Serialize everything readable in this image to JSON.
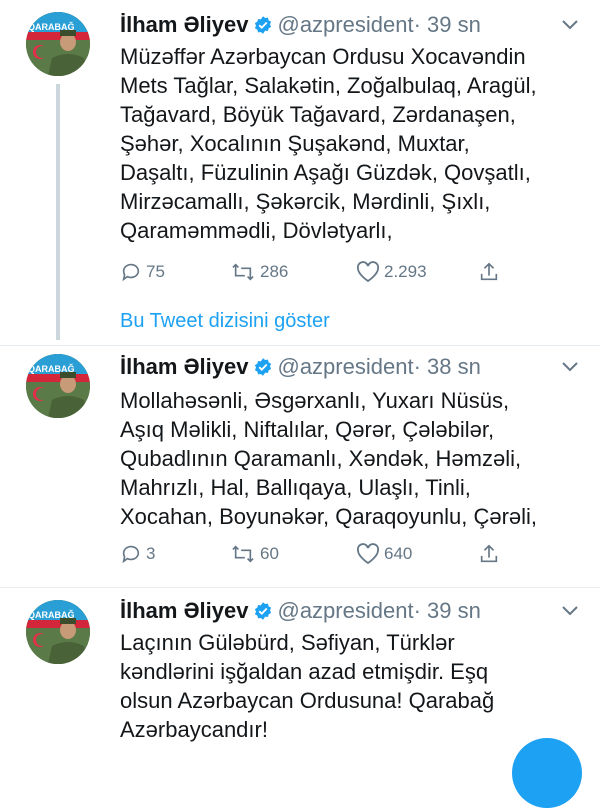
{
  "tweets": [
    {
      "name": "İlham Əliyev",
      "handle": "@azpresident",
      "dot": "·",
      "time": "39 sn",
      "lines": [
        "Müzəffər Azərbaycan Ordusu Xocavəndin",
        "Mets Tağlar, Salakətin, Zoğalbulaq, Aragül,",
        "Tağavard, Böyük Tağavard, Zərdanaşen,",
        "Şəhər, Xocalının Şuşakənd, Muxtar,",
        "Daşaltı, Füzulinin Aşağı Güzdək, Qovşatlı,",
        "Mirzəcamallı, Şəkərcik, Mərdinli, Şıxlı,",
        "Qaraməmmədli, Dövlətyarlı,"
      ],
      "replies": "75",
      "retweets": "286",
      "likes": "2.293"
    },
    {
      "name": "İlham Əliyev",
      "handle": "@azpresident",
      "dot": "·",
      "time": "38 sn",
      "lines": [
        "Mollahəsənli, Əsgərxanlı, Yuxarı Nüsüs,",
        "Aşıq Məlikli, Niftalılar, Qərər, Çələbilər,",
        "Qubadlının Qaramanlı, Xəndək, Həmzəli,",
        "Mahrızlı, Hal, Ballıqaya, Ulaşlı, Tinli,",
        "Xocahan, Boyunəkər, Qaraqoyunlu, Çərəli,"
      ],
      "replies": "3",
      "retweets": "60",
      "likes": "640"
    },
    {
      "name": "İlham Əliyev",
      "handle": "@azpresident",
      "dot": "·",
      "time": "39 sn",
      "lines": [
        "Laçının Güləbürd, Səfiyan, Türklər",
        "kəndlərini işğaldan azad etmişdir. Eşq",
        "olsun Azərbaycan Ordusuna! Qarabağ",
        "Azərbaycandır!"
      ]
    }
  ],
  "show_thread": "Bu Tweet dizisini göster",
  "avatar_text": "QARABAĞ",
  "icons": {
    "verified": "verified-badge-icon",
    "reply": "reply-icon",
    "retweet": "retweet-icon",
    "like": "heart-icon",
    "share": "share-icon",
    "menu": "chevron-down-icon"
  },
  "colors": {
    "accent": "#1da1f2",
    "muted": "#657786",
    "text": "#14171a"
  }
}
